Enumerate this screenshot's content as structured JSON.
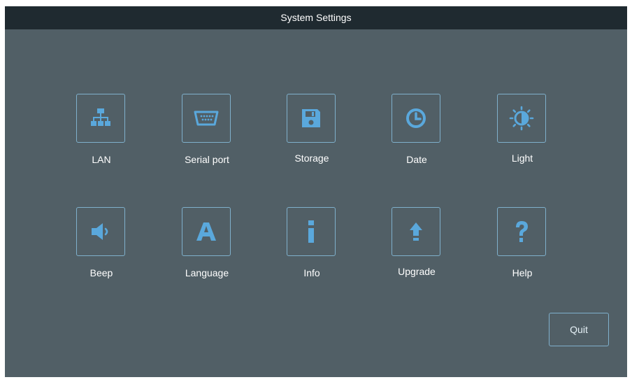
{
  "title": "System Settings",
  "accent_color": "#5aa8dc",
  "tiles": [
    {
      "label": "LAN",
      "icon": "network-icon"
    },
    {
      "label": "Serial port",
      "icon": "serial-port-icon"
    },
    {
      "label": "Storage",
      "icon": "floppy-disk-icon"
    },
    {
      "label": "Date",
      "icon": "clock-icon"
    },
    {
      "label": "Light",
      "icon": "brightness-icon"
    },
    {
      "label": "Beep",
      "icon": "speaker-icon"
    },
    {
      "label": "Language",
      "icon": "letter-a-icon"
    },
    {
      "label": "Info",
      "icon": "info-icon"
    },
    {
      "label": "Upgrade",
      "icon": "upload-arrow-icon"
    },
    {
      "label": "Help",
      "icon": "question-mark-icon"
    }
  ],
  "quit_label": "Quit"
}
